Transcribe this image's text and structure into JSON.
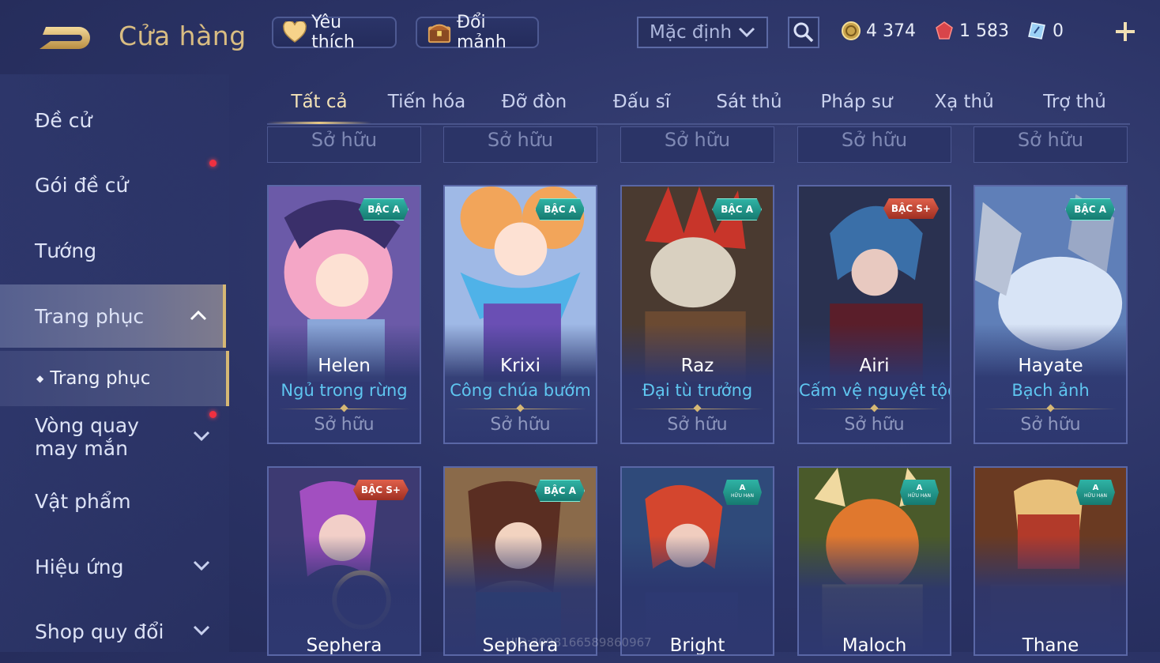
{
  "header": {
    "title": "Cửa hàng",
    "favorites_label": "Yêu thích",
    "exchange_label": "Đổi mảnh",
    "sort_value": "Mặc định",
    "currencies": {
      "gold": "4 374",
      "ruby": "1 583",
      "voucher": "0"
    }
  },
  "sidebar": {
    "items": [
      {
        "label": "Đề cử"
      },
      {
        "label": "Gói đề cử",
        "notify": true
      },
      {
        "label": "Tướng"
      },
      {
        "label": "Trang phục",
        "expanded": true
      },
      {
        "label": "Vòng quay may mắn",
        "notify": true
      },
      {
        "label": "Vật phẩm"
      },
      {
        "label": "Hiệu ứng"
      },
      {
        "label": "Shop quy đổi"
      }
    ],
    "sub_item": "Trang phục"
  },
  "tabs": [
    "Tất cả",
    "Tiến hóa",
    "Đỡ đòn",
    "Đấu sĩ",
    "Sát thủ",
    "Pháp sư",
    "Xạ thủ",
    "Trợ thủ"
  ],
  "active_tab": 0,
  "cut_off_label": "Sở hữu",
  "cards_row1": [
    {
      "hero": "Helen",
      "skin": "Ngủ trong rừng",
      "badge": "BẬC A",
      "status": "Sở hữu"
    },
    {
      "hero": "Krixi",
      "skin": "Công chúa bướm",
      "badge": "BẬC A",
      "status": "Sở hữu"
    },
    {
      "hero": "Raz",
      "skin": "Đại tù trưởng",
      "badge": "BẬC A",
      "status": "Sở hữu"
    },
    {
      "hero": "Airi",
      "skin": "Cấm vệ nguyệt tộc",
      "badge": "BẬC S+",
      "status": "Sở hữu"
    },
    {
      "hero": "Hayate",
      "skin": "Bạch ảnh",
      "badge": "BẬC A",
      "status": "Sở hữu"
    }
  ],
  "cards_row2": [
    {
      "hero": "Sephera",
      "badge": "BẬC S+"
    },
    {
      "hero": "Sephera",
      "badge": "BẬC A"
    },
    {
      "hero": "Bright",
      "badge": "A",
      "badge_sub": "HỮU HẠN"
    },
    {
      "hero": "Maloch",
      "badge": "A",
      "badge_sub": "HỮU HẠN"
    },
    {
      "hero": "Thane",
      "badge": "A",
      "badge_sub": "HỮU HẠN"
    }
  ],
  "watermark": "UID:2098166589860967",
  "colors": {
    "accent_gold": "#d6b874",
    "skin_name_blue": "#5fc6f0",
    "notify_red": "#f03040"
  }
}
